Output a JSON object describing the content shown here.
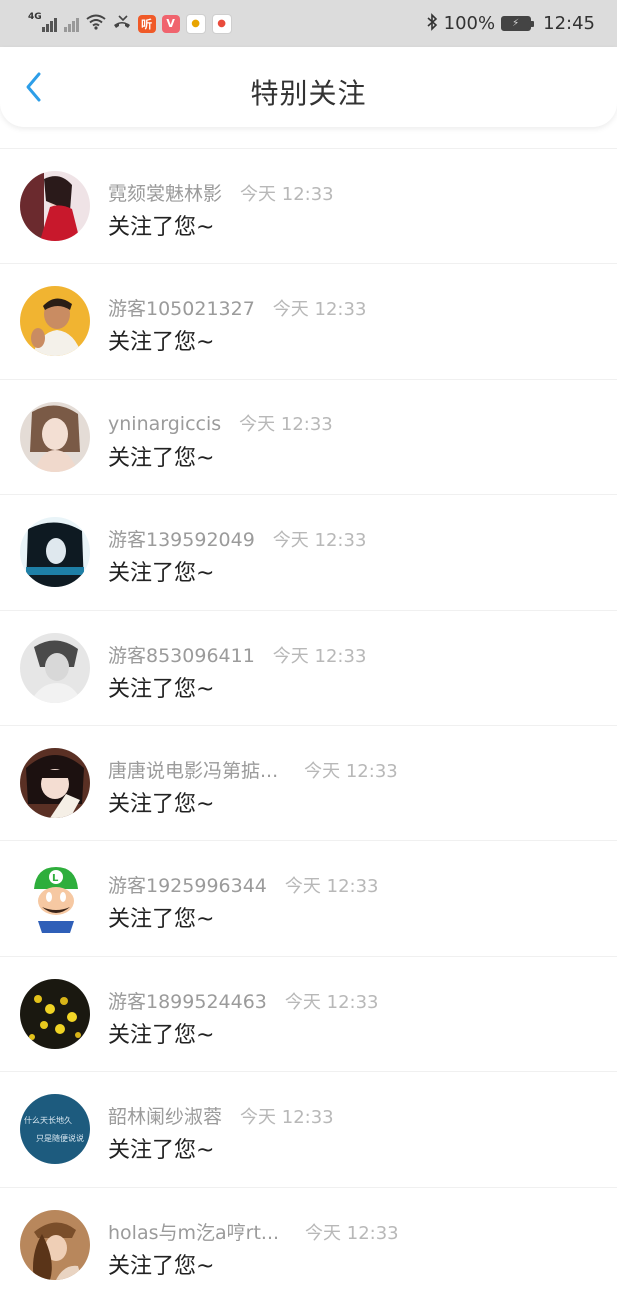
{
  "status_bar": {
    "network_label": "4G",
    "app_badge_ting": "听",
    "app_badge_v": "V",
    "battery": "100%",
    "time": "12:45"
  },
  "header": {
    "title": "特别关注"
  },
  "notifications": [
    {
      "name": "霓颏裳魅林影",
      "time": "今天 12:33",
      "action": "关注了您~",
      "avatar": "avatar-red-dress"
    },
    {
      "name": "游客105021327",
      "time": "今天 12:33",
      "action": "关注了您~",
      "avatar": "avatar-man-yellow"
    },
    {
      "name": "yninargiccis",
      "time": "今天 12:33",
      "action": "关注了您~",
      "avatar": "avatar-woman-pale"
    },
    {
      "name": "游客139592049",
      "time": "今天 12:33",
      "action": "关注了您~",
      "avatar": "avatar-dark-hair-blue"
    },
    {
      "name": "游客853096411",
      "time": "今天 12:33",
      "action": "关注了您~",
      "avatar": "avatar-grayscale"
    },
    {
      "name": "唐唐说电影冯第掂...",
      "time": "今天 12:33",
      "action": "关注了您~",
      "avatar": "avatar-girl-bangs"
    },
    {
      "name": "游客1925996344",
      "time": "今天 12:33",
      "action": "关注了您~",
      "avatar": "avatar-luigi"
    },
    {
      "name": "游客1899524463",
      "time": "今天 12:33",
      "action": "关注了您~",
      "avatar": "avatar-yellow-flowers"
    },
    {
      "name": "韶林阑纱淑蓉",
      "time": "今天 12:33",
      "action": "关注了您~",
      "avatar": "avatar-blue-text"
    },
    {
      "name": "holas与m汔a哼rt...",
      "time": "今天 12:33",
      "action": "关注了您~",
      "avatar": "avatar-woman-hat"
    }
  ],
  "avatar_text": {
    "blue_line1": "什么天长地久",
    "blue_line2": "只是随便说说"
  },
  "colors": {
    "status_bar_bg": "#dcdcdc",
    "back_arrow": "#2d9ee8",
    "name_text": "#9b9b9b",
    "time_text": "#b8b8b8"
  }
}
